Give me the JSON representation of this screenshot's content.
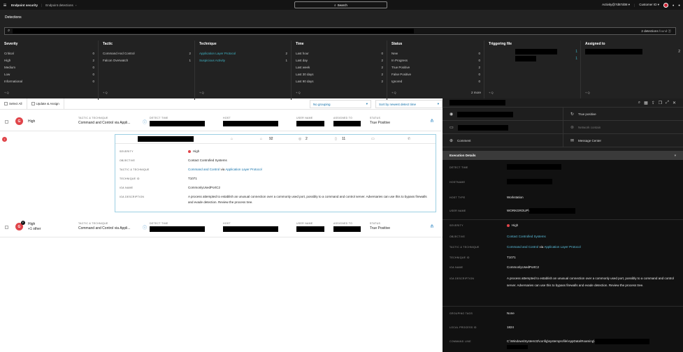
{
  "topbar": {
    "brand": "Endpoint security",
    "crumb": "Endpoint detections",
    "search": "Search",
    "activity": "Activity@7d87d08",
    "customer": "Customer ID"
  },
  "header": {
    "title": "Detections",
    "found": "2 detections",
    "found_suffix": "found"
  },
  "filters": [
    {
      "title": "Severity",
      "rows": [
        {
          "label": "Critical",
          "n": "0"
        },
        {
          "label": "High",
          "n": "2"
        },
        {
          "label": "Medium",
          "n": "0"
        },
        {
          "label": "Low",
          "n": "0"
        },
        {
          "label": "Informational",
          "n": "0"
        }
      ]
    },
    {
      "title": "Tactic",
      "rows": [
        {
          "label": "Command And Control",
          "n": "2"
        },
        {
          "label": "Falcon Overwatch",
          "n": "1"
        }
      ]
    },
    {
      "title": "Technique",
      "rows": [
        {
          "label": "Application Layer Protocol",
          "n": "2",
          "link": true
        },
        {
          "label": "Suspicious Activity",
          "n": "1",
          "link": true
        }
      ]
    },
    {
      "title": "Time",
      "rows": [
        {
          "label": "Last hour",
          "n": "0"
        },
        {
          "label": "Last day",
          "n": "2"
        },
        {
          "label": "Last week",
          "n": "2"
        },
        {
          "label": "Last 30 days",
          "n": "2"
        },
        {
          "label": "Last 90 days",
          "n": "2"
        }
      ]
    },
    {
      "title": "Status",
      "rows": [
        {
          "label": "New",
          "n": "0"
        },
        {
          "label": "In Progress",
          "n": "0"
        },
        {
          "label": "True Positive",
          "n": "2"
        },
        {
          "label": "False Positive",
          "n": "0"
        },
        {
          "label": "Ignored",
          "n": "0"
        }
      ],
      "more": "2 more"
    },
    {
      "title": "Triggering file",
      "rows": []
    },
    {
      "title": "Assigned to",
      "rows": []
    }
  ],
  "filter_plus": "+ Q",
  "toolbar": {
    "select_all": "Select All",
    "update_assign": "Update & Assign",
    "grouping": "No grouping",
    "sort": "Sort by newest detect time"
  },
  "rows": [
    {
      "severity": "High",
      "extra": "",
      "tactic_label": "TACTIC & TECHNIQUE",
      "tactic": "Command and Control via Appli...",
      "time_label": "DETECT TIME",
      "host_label": "HOST",
      "user_label": "USER NAME",
      "assigned_label": "ASSIGNED TO",
      "status_label": "STATUS",
      "status": "True Positive"
    },
    {
      "severity": "High",
      "extra": "+1 other",
      "tactic_label": "TACTIC & TECHNIQUE",
      "tactic": "Command and Control via Appli...",
      "time_label": "DETECT TIME",
      "host_label": "HOST",
      "user_label": "USER NAME",
      "assigned_label": "ASSIGNED TO",
      "status_label": "STATUS",
      "status": "True Positive"
    }
  ],
  "card": {
    "c1": "92",
    "c2": "2",
    "c3": "11",
    "severity_k": "SEVERITY",
    "severity": "High",
    "objective_k": "OBJECTIVE",
    "objective": "Contact Controlled Systems",
    "tt_k": "TACTIC & TECHNIQUE",
    "tt_a": "Command and Control",
    "tt_via": "via",
    "tt_b": "Application Layer Protocol",
    "tid_k": "TECHNIQUE ID",
    "tid": "T1071",
    "ioa_k": "IOA NAME",
    "ioa": "CommonlyUsedPortC2",
    "desc_k": "IOA DESCRIPTION",
    "desc": "A process attempted to establish an unusual connection over a commonly used port, possibly to a command and control server. Adversaries can use this to bypass firewalls and evade detection. Review the process tree."
  },
  "panel": {
    "true_positive": "True positive",
    "network_contain": "Network contain",
    "comment": "Comment",
    "message_center": "Message Center",
    "exec_title": "Execution Details",
    "detect_k": "DETECT TIME",
    "hostname_k": "HOSTNAME",
    "hosttype_k": "HOST TYPE",
    "hosttype": "Workstation",
    "username_k": "USER NAME",
    "username": "WORKGROUP\\",
    "severity_k": "SEVERITY",
    "severity": "High",
    "objective_k": "OBJECTIVE",
    "objective": "Contact Controlled Systems",
    "tt_k": "TACTIC & TECHNIQUE",
    "tt_a": "Command and Control",
    "tt_via": "via",
    "tt_b": "Application Layer Protocol",
    "tid_k": "TECHNIQUE ID",
    "tid": "T1071",
    "ioa_k": "IOA NAME",
    "ioa": "CommonlyUsedPortC2",
    "desc_k": "IOA DESCRIPTION",
    "desc": "A process attempted to establish an unusual connection over a commonly used port, possibly to a command and control server. Adversaries can use this to bypass firewalls and evade detection. Review the process tree.",
    "gt_k": "GROUPING TAGS",
    "gt": "None",
    "lpid_k": "LOCAL PROCESS ID",
    "lpid": "1824",
    "cmd_k": "COMMAND LINE",
    "cmd": "C:\\Windows\\System32\\config\\systemprofile\\AppData\\Roaming\\"
  },
  "colors": {
    "accent": "#0e6ea8",
    "severity_high": "#e0454a",
    "link_dark": "#3fb4c6"
  },
  "icons": [
    "menu-icon",
    "bookmark-icon",
    "search-icon",
    "chevron-down-icon",
    "avatar-icon",
    "bell-icon",
    "user-icon",
    "host-icon",
    "info-icon",
    "comment-icon",
    "mail-icon",
    "check-icon",
    "shield-icon"
  ]
}
